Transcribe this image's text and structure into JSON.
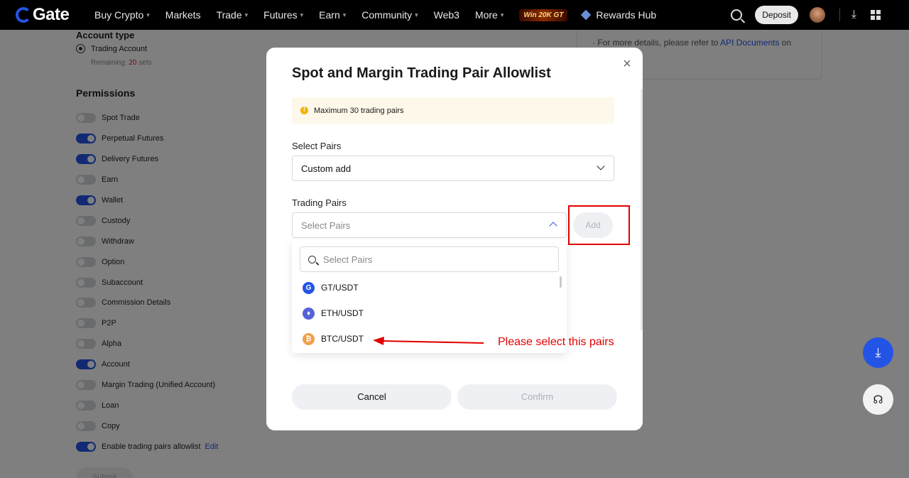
{
  "nav": {
    "logo_text": "Gate",
    "items": [
      {
        "label": "Buy Crypto",
        "caret": true
      },
      {
        "label": "Markets",
        "caret": false
      },
      {
        "label": "Trade",
        "caret": true
      },
      {
        "label": "Futures",
        "caret": true
      },
      {
        "label": "Earn",
        "caret": true
      },
      {
        "label": "Community",
        "caret": true
      },
      {
        "label": "Web3",
        "caret": false
      },
      {
        "label": "More",
        "caret": true
      }
    ],
    "promo": "Win 20K GT",
    "rewards": "Rewards Hub",
    "deposit": "Deposit",
    "icons": [
      "search-icon",
      "avatar",
      "download-icon",
      "apps-grid-icon"
    ]
  },
  "background": {
    "account_type_title": "Account type",
    "account_option": "Trading Account",
    "remaining_prefix": "Remaining: ",
    "remaining_num": "20",
    "remaining_suffix": " sets",
    "permissions_title": "Permissions",
    "permissions": [
      {
        "label": "Spot Trade",
        "on": false
      },
      {
        "label": "Perpetual Futures",
        "on": true
      },
      {
        "label": "Delivery Futures",
        "on": true
      },
      {
        "label": "Earn",
        "on": false
      },
      {
        "label": "Wallet",
        "on": true
      },
      {
        "label": "Custody",
        "on": false
      },
      {
        "label": "Withdraw",
        "on": false
      },
      {
        "label": "Option",
        "on": false
      },
      {
        "label": "Subaccount",
        "on": false
      },
      {
        "label": "Commission Details",
        "on": false
      },
      {
        "label": "P2P",
        "on": false
      },
      {
        "label": "Alpha",
        "on": false
      },
      {
        "label": "Account",
        "on": true
      },
      {
        "label": "Margin Trading (Unified Account)",
        "on": false
      },
      {
        "label": "Loan",
        "on": false
      },
      {
        "label": "Copy",
        "on": false
      },
      {
        "label": "Enable trading pairs allowlist",
        "on": true
      }
    ],
    "edit_link": "Edit",
    "submit": "Submit",
    "info_prefix": "· For more details, please refer to ",
    "info_link": "API Documents",
    "info_suffix": " on"
  },
  "modal": {
    "title": "Spot and Margin Trading Pair Allowlist",
    "notice": "Maximum 30 trading pairs",
    "select_label": "Select Pairs",
    "select_value": "Custom add",
    "pairs_label": "Trading Pairs",
    "pairs_placeholder": "Select Pairs",
    "add_button": "Add",
    "search_placeholder": "Select Pairs",
    "pairs": [
      {
        "name": "GT/USDT",
        "coin": "gt",
        "glyph": "G"
      },
      {
        "name": "ETH/USDT",
        "coin": "eth",
        "glyph": "♦"
      },
      {
        "name": "BTC/USDT",
        "coin": "btc",
        "glyph": "₿"
      }
    ],
    "annotation": "Please select this pairs",
    "cancel": "Cancel",
    "confirm": "Confirm"
  },
  "colors": {
    "brand": "#2354e6",
    "annotation": "#e00000",
    "warning": "#f5b400"
  }
}
